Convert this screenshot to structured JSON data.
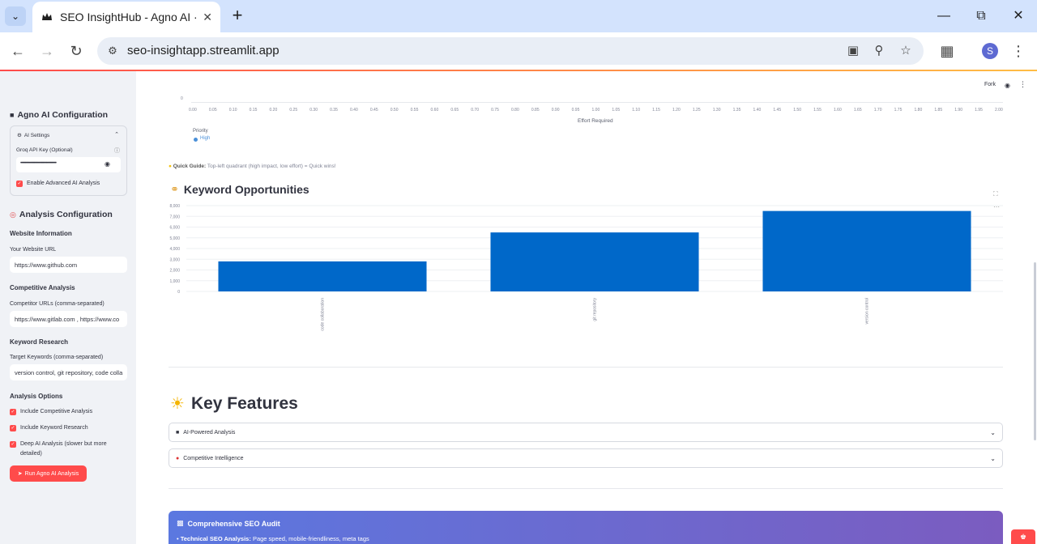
{
  "browser": {
    "tab_title": "SEO InsightHub - Agno AI · Streamlit",
    "url": "seo-insightapp.streamlit.app",
    "avatar_letter": "S"
  },
  "sidebar": {
    "agno_title": "Agno AI Configuration",
    "ai_settings": "AI Settings",
    "groq_label": "Groq API Key (Optional)",
    "groq_value": "••••••••••••••••••••••••••••••••••••••••",
    "enable_advanced": "Enable Advanced AI Analysis",
    "analysis_title": "Analysis Configuration",
    "website_info": "Website Information",
    "website_label": "Your Website URL",
    "website_value": "https://www.github.com",
    "competitive_title": "Competitive Analysis",
    "competitor_label": "Competitor URLs (comma-separated)",
    "competitor_value": "https://www.gitlab.com , https://www.co",
    "keyword_title": "Keyword Research",
    "keywords_label": "Target Keywords (comma-separated)",
    "keywords_value": "version control, git repository, code colla",
    "options_title": "Analysis Options",
    "opt_competitive": "Include Competitive Analysis",
    "opt_keyword": "Include Keyword Research",
    "opt_deep": "Deep AI Analysis (slower but more detailed)",
    "run_button": "Run Agno AI Analysis"
  },
  "header": {
    "fork": "Fork"
  },
  "scatter_axis": {
    "y_zero": "0",
    "x_ticks": [
      "0.00",
      "0.05",
      "0.10",
      "0.15",
      "0.20",
      "0.25",
      "0.30",
      "0.35",
      "0.40",
      "0.45",
      "0.50",
      "0.55",
      "0.60",
      "0.65",
      "0.70",
      "0.75",
      "0.80",
      "0.85",
      "0.90",
      "0.95",
      "1.00",
      "1.05",
      "1.10",
      "1.15",
      "1.20",
      "1.25",
      "1.30",
      "1.35",
      "1.40",
      "1.45",
      "1.50",
      "1.55",
      "1.60",
      "1.65",
      "1.70",
      "1.75",
      "1.80",
      "1.85",
      "1.90",
      "1.95",
      "2.00"
    ],
    "x_title": "Effort Required",
    "legend_title": "Priority",
    "legend_item": "High",
    "legend_color": "#4a90d9"
  },
  "quick_guide": {
    "label": "Quick Guide:",
    "text": "Top-left quadrant (high impact, low effort) = Quick wins!"
  },
  "keyword_section": {
    "title": "Keyword Opportunities"
  },
  "chart_data": {
    "type": "bar",
    "categories": [
      "code collaboration",
      "git repository",
      "version control"
    ],
    "values": [
      2800,
      5500,
      7500
    ],
    "ylim": [
      0,
      8000
    ],
    "y_ticks": [
      "0",
      "1,000",
      "2,000",
      "3,000",
      "4,000",
      "5,000",
      "6,000",
      "7,000",
      "8,000"
    ],
    "color": "#0068c9",
    "grid": true
  },
  "features": {
    "title": "Key Features",
    "items": [
      "AI-Powered Analysis",
      "Competitive Intelligence"
    ]
  },
  "audit": {
    "title": "Comprehensive SEO Audit",
    "line_bold": "Technical SEO Analysis:",
    "line_text": "Page speed, mobile-friendliness, meta tags"
  }
}
